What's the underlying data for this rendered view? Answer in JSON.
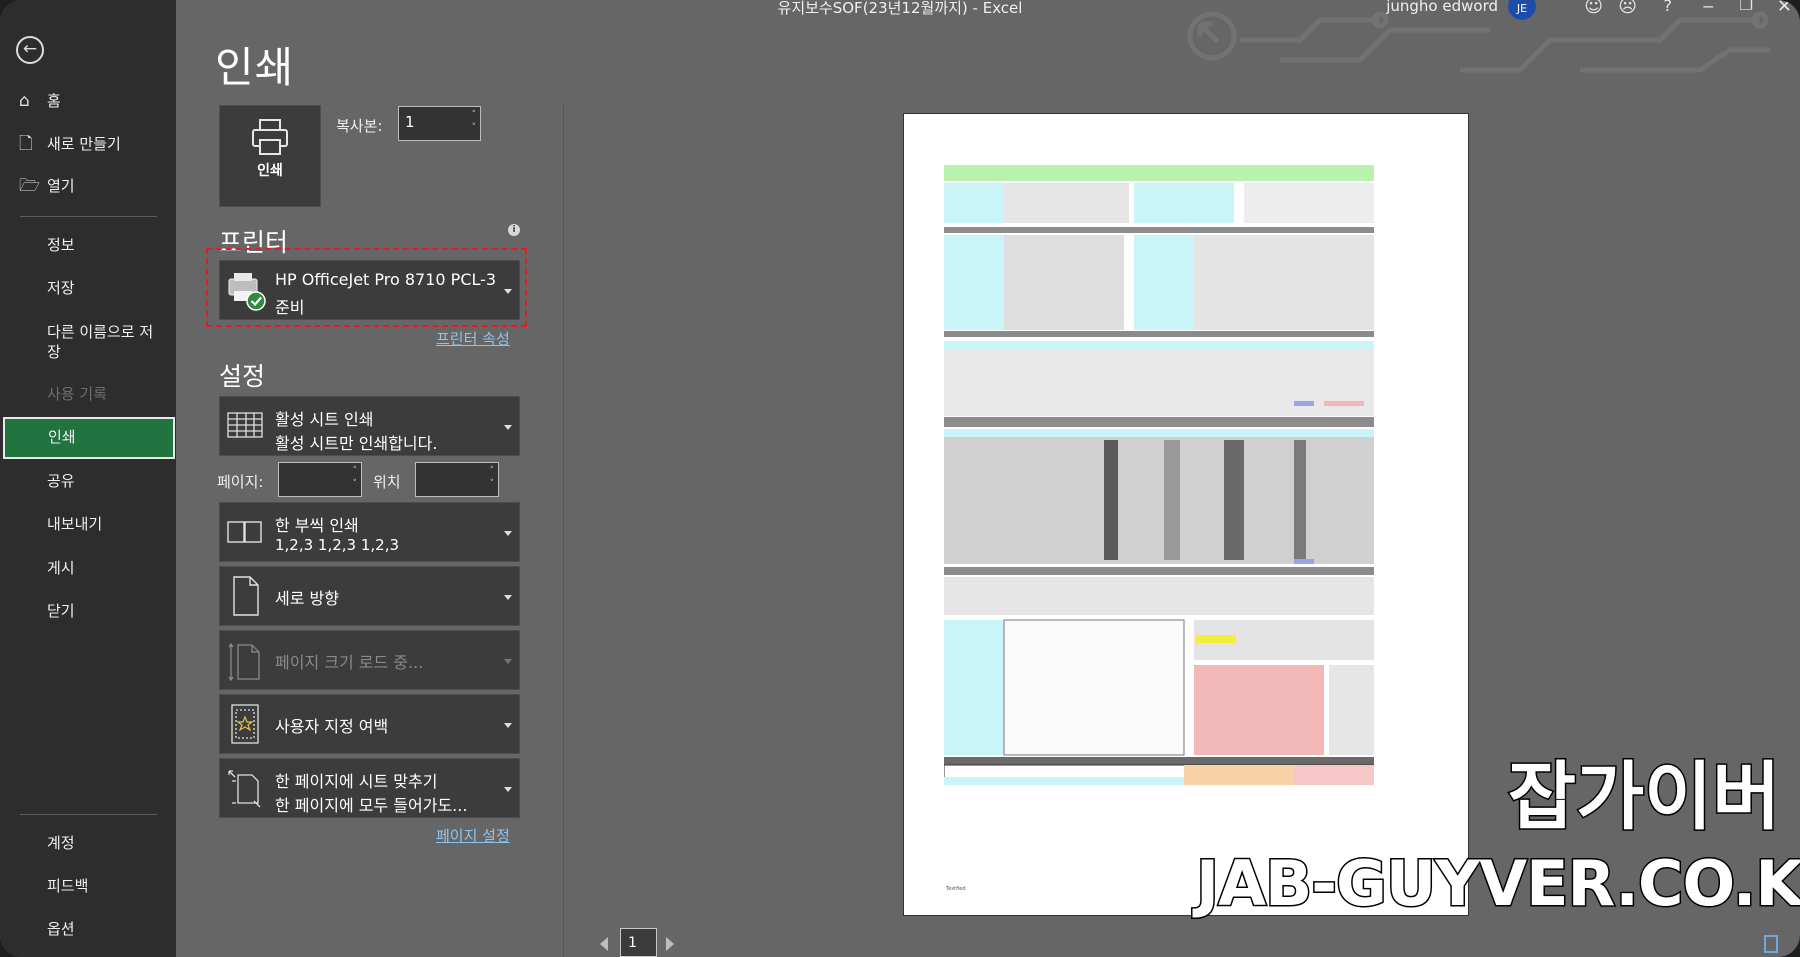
{
  "titlebar": {
    "title": "유지보수SOF(23년12월까지)  -  Excel",
    "user_name": "jungho edword",
    "avatar_initials": "JE"
  },
  "sidebar": {
    "items": [
      {
        "label": "홈",
        "icon": "home-icon"
      },
      {
        "label": "새로 만들기",
        "icon": "new-document-icon"
      },
      {
        "label": "열기",
        "icon": "open-folder-icon"
      },
      {
        "label": "정보"
      },
      {
        "label": "저장"
      },
      {
        "label": "다른 이름으로 저장"
      },
      {
        "label": "사용 기록"
      },
      {
        "label": "인쇄"
      },
      {
        "label": "공유"
      },
      {
        "label": "내보내기"
      },
      {
        "label": "게시"
      },
      {
        "label": "닫기"
      }
    ],
    "bottom": [
      {
        "label": "계정"
      },
      {
        "label": "피드백"
      },
      {
        "label": "옵션"
      }
    ]
  },
  "print": {
    "heading": "인쇄",
    "button_label": "인쇄",
    "copies_label": "복사본:",
    "copies_value": "1"
  },
  "printer": {
    "section_label": "프린터",
    "name": "HP OfficeJet Pro 8710 PCL-3",
    "status": "준비",
    "properties_link": "프린터 속성"
  },
  "settings": {
    "section_label": "설정",
    "what": {
      "title": "활성 시트 인쇄",
      "desc": "활성 시트만 인쇄합니다."
    },
    "pages_label": "페이지:",
    "pages_value": "",
    "to_label": "위치",
    "to_value": "",
    "collate": {
      "title": "한 부씩 인쇄",
      "desc": "1,2,3    1,2,3    1,2,3"
    },
    "orientation": {
      "title": "세로 방향"
    },
    "paper_size": {
      "title": "페이지 크기 로드 중..."
    },
    "margins": {
      "title": "사용자 지정 여백"
    },
    "scaling": {
      "title": "한 페이지에 시트 맞추기",
      "desc": "한 페이지에 모두 들어가도..."
    },
    "page_setup_link": "페이지 설정"
  },
  "preview": {
    "page_number": "1",
    "footer_text": "Textfied"
  },
  "watermark": {
    "korean": "잡가이버",
    "english": "JAB-GUYVER.CO.KR"
  },
  "colors": {
    "sidebar_bg": "#2d2d2d",
    "main_bg": "#666666",
    "active_nav": "#21733f",
    "highlight_border": "#e31b23",
    "link": "#8dc4ef"
  }
}
